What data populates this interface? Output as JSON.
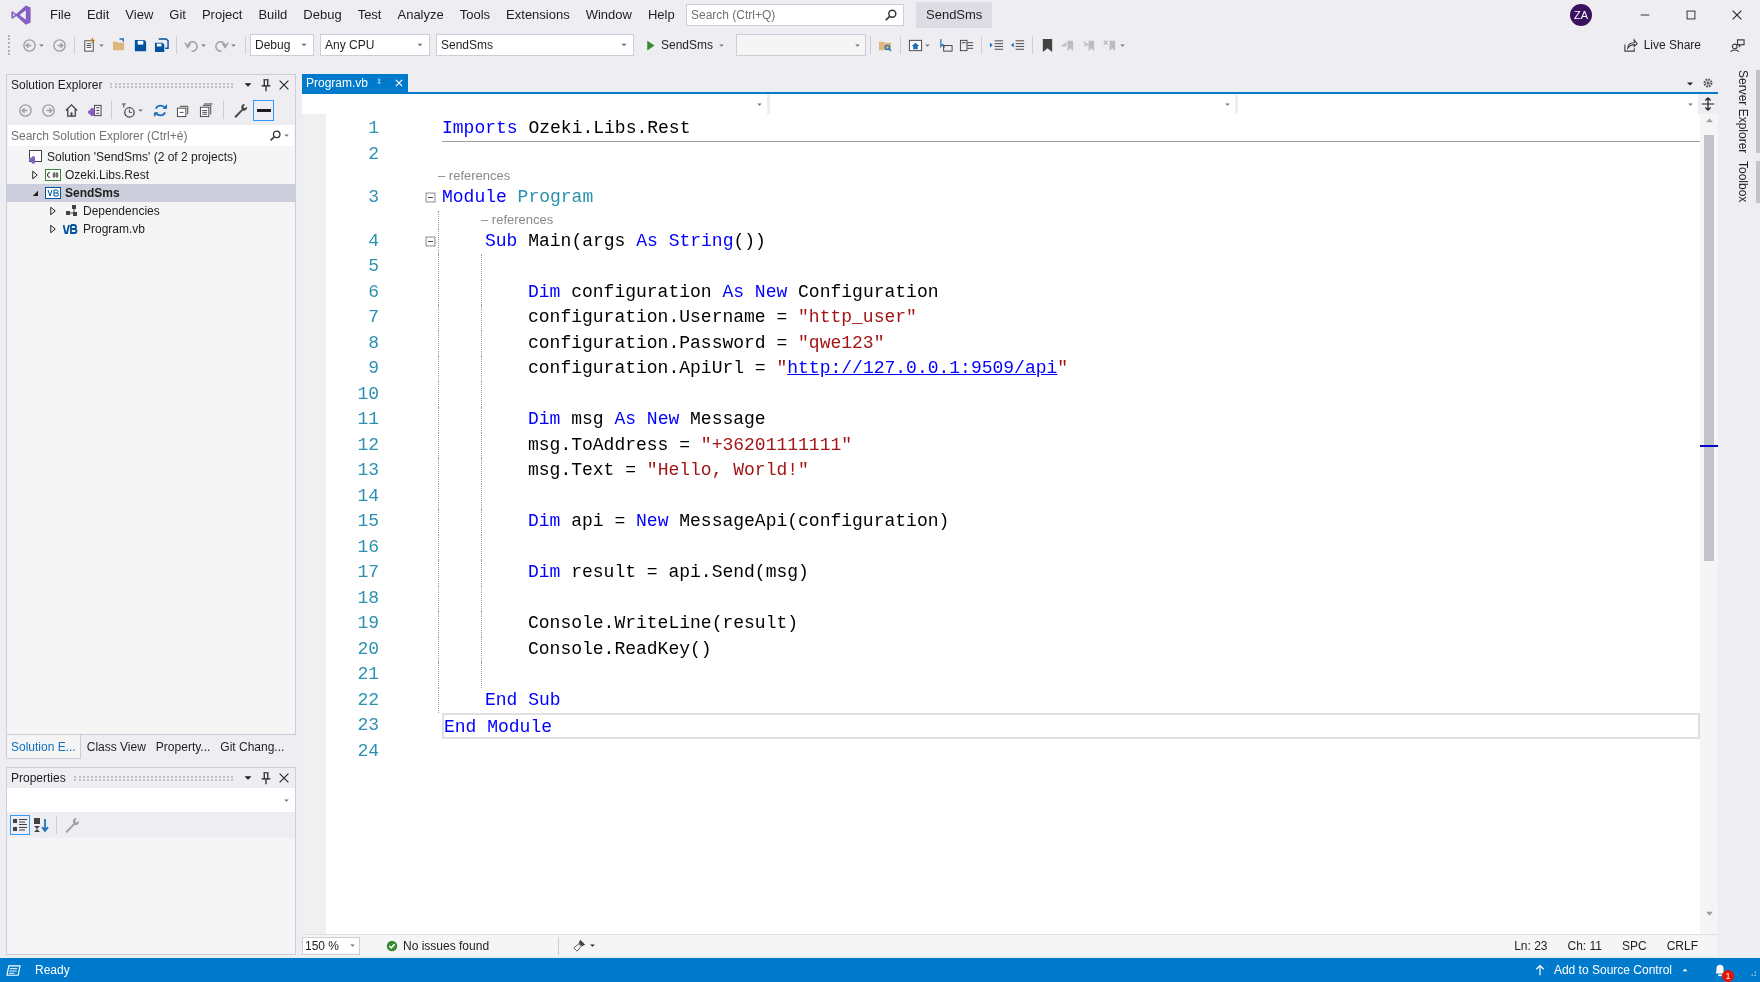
{
  "menu": [
    "File",
    "Edit",
    "View",
    "Git",
    "Project",
    "Build",
    "Debug",
    "Test",
    "Analyze",
    "Tools",
    "Extensions",
    "Window",
    "Help"
  ],
  "search": {
    "placeholder": "Search (Ctrl+Q)"
  },
  "title": "SendSms",
  "avatar": "ZA",
  "toolbar": {
    "configuration": "Debug",
    "platform": "Any CPU",
    "startup_project": "SendSms",
    "run_label": "SendSms",
    "live_share": "Live Share"
  },
  "solution_explorer": {
    "title": "Solution Explorer",
    "search_placeholder": "Search Solution Explorer (Ctrl+é)",
    "tree": [
      {
        "label": "Solution 'SendSms' (2 of 2 projects)",
        "kind": "solution",
        "selected": false,
        "children": [
          {
            "label": "Ozeki.Libs.Rest",
            "kind": "csproj",
            "expanded": false,
            "selected": false
          },
          {
            "label": "SendSms",
            "kind": "vbproj",
            "expanded": true,
            "selected": true,
            "children": [
              {
                "label": "Dependencies",
                "kind": "dependencies",
                "expanded": false,
                "selected": false
              },
              {
                "label": "Program.vb",
                "kind": "vbfile",
                "expanded": false,
                "selected": false
              }
            ]
          }
        ]
      }
    ]
  },
  "panel_tabs": [
    {
      "label": "Solution E...",
      "selected": true
    },
    {
      "label": "Class View",
      "selected": false
    },
    {
      "label": "Property...",
      "selected": false
    },
    {
      "label": "Git Chang...",
      "selected": false
    }
  ],
  "properties": {
    "title": "Properties"
  },
  "editor": {
    "tabs": [
      {
        "label": "Program.vb",
        "selected": true
      }
    ],
    "lines": [
      {
        "number": "1",
        "separator": true,
        "tokens": [
          {
            "kind": "keyword",
            "text": "Imports"
          },
          {
            "kind": "plain",
            "text": " Ozeki.Libs.Rest"
          }
        ]
      },
      {
        "number": "2"
      },
      {
        "number": "3",
        "codelens": "– references",
        "expanded": true,
        "tokens": [
          {
            "kind": "keyword",
            "text": "Module"
          },
          {
            "kind": "type",
            "text": " Program"
          }
        ],
        "children": [
          {
            "number": "4",
            "codelens": "– references",
            "expanded": true,
            "tokens": [
              {
                "kind": "keyword",
                "text": "Sub"
              },
              {
                "kind": "plain",
                "text": " Main(args "
              },
              {
                "kind": "keyword",
                "text": "As"
              },
              {
                "kind": "keyword",
                "text": " String"
              },
              {
                "kind": "plain",
                "text": "())"
              }
            ],
            "children": [
              {
                "number": "5"
              },
              {
                "number": "6",
                "tokens": [
                  {
                    "kind": "keyword",
                    "text": "Dim"
                  },
                  {
                    "kind": "plain",
                    "text": " configuration "
                  },
                  {
                    "kind": "keyword",
                    "text": "As"
                  },
                  {
                    "kind": "keyword",
                    "text": " New"
                  },
                  {
                    "kind": "plain",
                    "text": " Configuration"
                  }
                ]
              },
              {
                "number": "7",
                "tokens": [
                  {
                    "kind": "plain",
                    "text": "configuration.Username = "
                  },
                  {
                    "kind": "string",
                    "text": "\"http_user\""
                  }
                ]
              },
              {
                "number": "8",
                "tokens": [
                  {
                    "kind": "plain",
                    "text": "configuration.Password = "
                  },
                  {
                    "kind": "string",
                    "text": "\"qwe123\""
                  }
                ]
              },
              {
                "number": "9",
                "tokens": [
                  {
                    "kind": "plain",
                    "text": "configuration.ApiUrl = "
                  },
                  {
                    "kind": "string",
                    "text": "\""
                  },
                  {
                    "kind": "link",
                    "text": "http://127.0.0.1:9509/api"
                  },
                  {
                    "kind": "string",
                    "text": "\""
                  }
                ]
              },
              {
                "number": "10"
              },
              {
                "number": "11",
                "tokens": [
                  {
                    "kind": "keyword",
                    "text": "Dim"
                  },
                  {
                    "kind": "plain",
                    "text": " msg "
                  },
                  {
                    "kind": "keyword",
                    "text": "As"
                  },
                  {
                    "kind": "keyword",
                    "text": " New"
                  },
                  {
                    "kind": "plain",
                    "text": " Message"
                  }
                ]
              },
              {
                "number": "12",
                "tokens": [
                  {
                    "kind": "plain",
                    "text": "msg.ToAddress = "
                  },
                  {
                    "kind": "string",
                    "text": "\"+36201111111\""
                  }
                ]
              },
              {
                "number": "13",
                "tokens": [
                  {
                    "kind": "plain",
                    "text": "msg.Text = "
                  },
                  {
                    "kind": "string",
                    "text": "\"Hello, World!\""
                  }
                ]
              },
              {
                "number": "14"
              },
              {
                "number": "15",
                "tokens": [
                  {
                    "kind": "keyword",
                    "text": "Dim"
                  },
                  {
                    "kind": "plain",
                    "text": " api = "
                  },
                  {
                    "kind": "keyword",
                    "text": "New"
                  },
                  {
                    "kind": "plain",
                    "text": " MessageApi(configuration)"
                  }
                ]
              },
              {
                "number": "16"
              },
              {
                "number": "17",
                "tokens": [
                  {
                    "kind": "keyword",
                    "text": "Dim"
                  },
                  {
                    "kind": "plain",
                    "text": " result = api.Send(msg)"
                  }
                ]
              },
              {
                "number": "18"
              },
              {
                "number": "19",
                "tokens": [
                  {
                    "kind": "plain",
                    "text": "Console.WriteLine(result)"
                  }
                ]
              },
              {
                "number": "20",
                "tokens": [
                  {
                    "kind": "plain",
                    "text": "Console.ReadKey()"
                  }
                ]
              },
              {
                "number": "21"
              }
            ]
          },
          {
            "number": "22",
            "tokens": [
              {
                "kind": "keyword",
                "text": "End Sub"
              }
            ]
          }
        ]
      },
      {
        "number": "23",
        "current": true,
        "tokens": [
          {
            "kind": "keyword",
            "text": "End Module"
          }
        ]
      },
      {
        "number": "24"
      }
    ],
    "zoom": "150 %",
    "issues": "No issues found",
    "line": "Ln: 23",
    "column": "Ch: 11",
    "whitespace": "SPC",
    "line_endings": "CRLF"
  },
  "side_tabs": [
    "Server Explorer",
    "Toolbox"
  ],
  "status_bar": {
    "text": "Ready",
    "source_control": "Add to Source Control",
    "notifications": "1"
  }
}
